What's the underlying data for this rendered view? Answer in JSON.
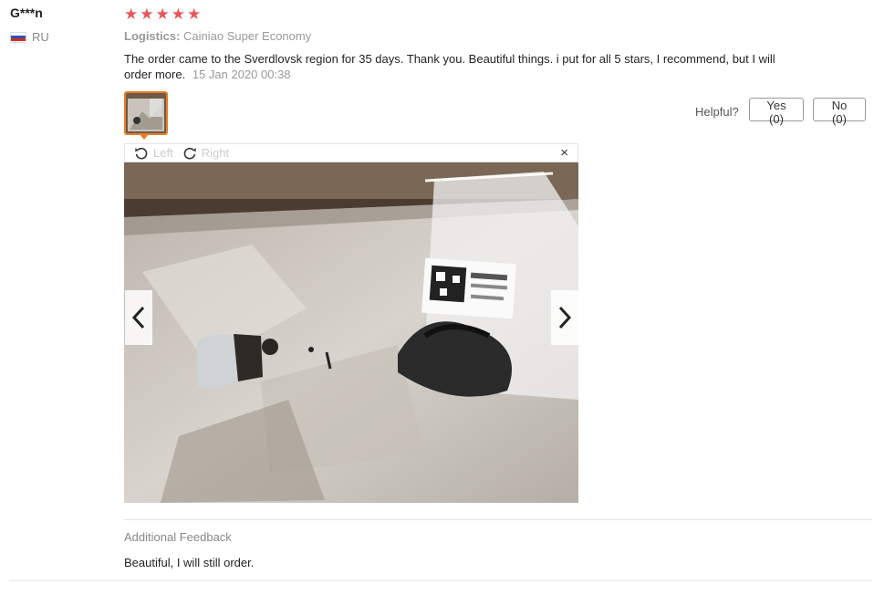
{
  "reviewer": {
    "name": "G***n",
    "country": "RU"
  },
  "rating": {
    "stars": 5,
    "symbols": [
      "★",
      "★",
      "★",
      "★",
      "★"
    ]
  },
  "logistics": {
    "label": "Logistics:",
    "value": "Cainiao Super Economy"
  },
  "review": {
    "text": "The order came to the Sverdlovsk region for 35 days. Thank you. Beautiful things. i put for all 5 stars, I recommend, but I will order more.",
    "date": "15 Jan 2020 00:38"
  },
  "helpful": {
    "label": "Helpful?",
    "yes": "Yes (0)",
    "no": "No (0)"
  },
  "viewer": {
    "rotate_left": "Left",
    "rotate_right": "Right",
    "close": "×"
  },
  "additional": {
    "title": "Additional Feedback",
    "text": "Beautiful, I will still order."
  },
  "colors": {
    "star": "#e8555a",
    "thumb_border": "#e67e22",
    "muted": "#999999"
  }
}
